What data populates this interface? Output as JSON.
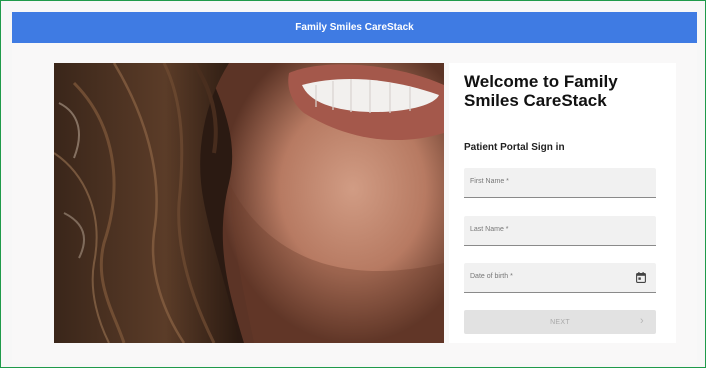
{
  "app": {
    "header_title": "Family Smiles CareStack"
  },
  "login": {
    "welcome_title": "Welcome to Family Smiles CareStack",
    "subtitle": "Patient Portal Sign in",
    "fields": {
      "first_name": "First Name *",
      "last_name": "Last Name *",
      "dob": "Date of birth *"
    },
    "next_label": "NEXT",
    "next_chevron": "›"
  },
  "icons": {
    "calendar": "calendar-icon",
    "chevron": "chevron-right-icon"
  },
  "colors": {
    "header": "#3f7be3",
    "border": "#1f9a4a",
    "field_bg": "#f1f1f1",
    "button_disabled": "#e2e2e2"
  }
}
